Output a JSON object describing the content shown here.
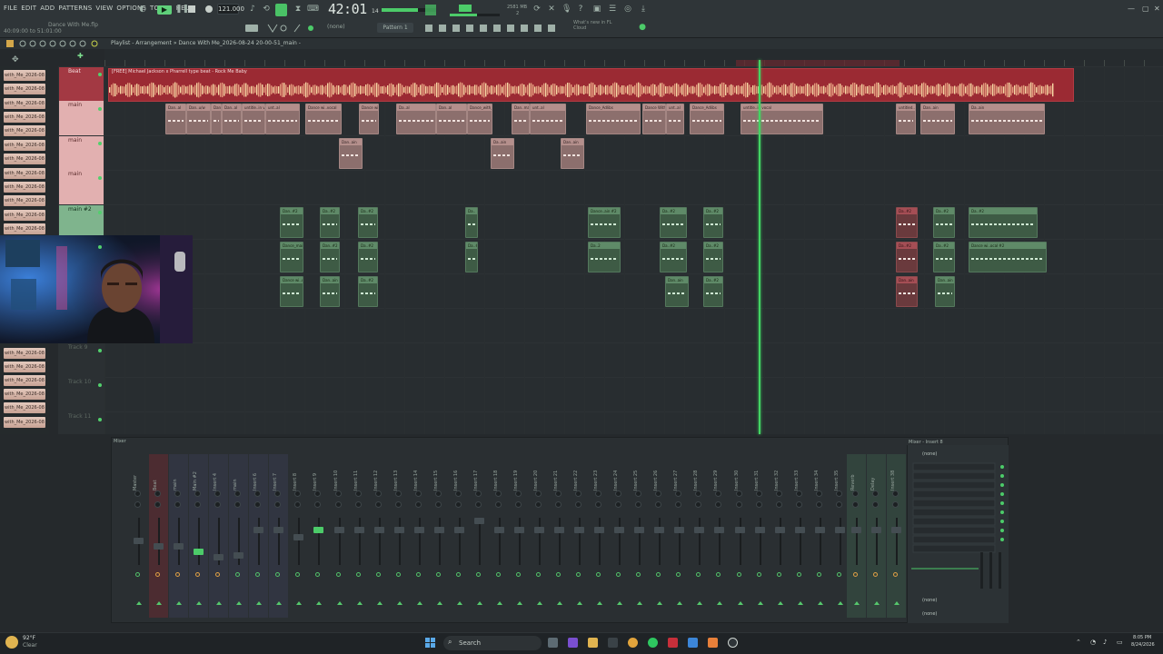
{
  "menu": [
    "FILE",
    "EDIT",
    "ADD",
    "PATTERNS",
    "VIEW",
    "OPTIONS",
    "TOOLS",
    "HELP"
  ],
  "project": {
    "name": "Dance With Me.flp",
    "time": "40:09:00 to 51:01:00"
  },
  "transport": {
    "tempo": "121.000",
    "time": "42:01",
    "time_small": "14",
    "cpu": "2581 MB",
    "cpu2": "2"
  },
  "toolbar": {
    "pattern": "Pattern 1",
    "none": "(none)",
    "news": "What's new in FL",
    "news_sub": "Cloud"
  },
  "playlist": {
    "title": "Playlist - Arrangement » Dance With Me_2026-08-24 20-00-51_main -"
  },
  "picker": [
    "with_Me_2026-08",
    "with_Me_2026-08",
    "with_Me_2026-08",
    "with_Me_2026-08",
    "with_Me_2026-08",
    "with_Me_2026-08",
    "with_Me_2026-08",
    "with_Me_2026-08",
    "with_Me_2026-08",
    "with_Me_2026-08",
    "with_Me_2026-08",
    "with_Me_2026-08",
    "with_Me_2026-08",
    "with_Me_2026-08",
    "with_Me_2026-08",
    "with_Me_2026-08",
    "with_Me_2026-08",
    "with_Me_2026-08",
    "with_Me_2026-08"
  ],
  "tracks": [
    "Beat",
    "main",
    "main",
    "main",
    "main #2",
    "Track 9",
    "Track 10",
    "Track 11"
  ],
  "beat_clip": {
    "label": "[FREE] Michael Jackson x Pharrell type beat - Rock Me Baby"
  },
  "clips_pink": [
    "Dan..al",
    "Dan..u/w",
    "Dan..al",
    "Dan..al",
    "untitle..in vocal",
    "unt..al",
    "Dance wi..vocal",
    "Dance wi..vocal",
    "Da..al",
    "Dan..al",
    "Dance_with_16-15_main",
    "Dan..mai",
    "unt..al",
    "Dance_Adlibs",
    "Dance With Me_202...23 23-15-21_main",
    "unt..al",
    "Dance_Adlibs",
    "untitle..in vocal",
    "untitled..in vocal",
    "Dan..ain",
    "Da..ain",
    "Dan..ain"
  ],
  "clips_green": [
    "Dan..#2",
    "Da..#2",
    "Da..#2",
    "Da..",
    "Dance..ain #2",
    "Da..#2",
    "Da..#2",
    "Da..#2",
    "Da..#2",
    "Dance_main #2",
    "Dan..#2",
    "Da..#2",
    "Da..#2",
    "Da..2",
    "Da..#2",
    "Da..#2",
    "Da..#2",
    "Dance wi..ocal #2",
    "Dance wi..ocal #2",
    "Dan..ain",
    "Da..#2",
    "Dan..ain",
    "Da..#2",
    "Dan..ain"
  ],
  "mixer": {
    "title": "Mixer",
    "insert_title": "Mixer - Insert 8",
    "none1": "(none)",
    "none2": "(none)",
    "none3": "(none)",
    "channels": [
      "Master",
      "Beat",
      "main",
      "Main #2",
      "Insert 4",
      "main",
      "Insert 6",
      "Insert 7",
      "Insert 8",
      "Insert 9",
      "Insert 10",
      "Insert 11",
      "Insert 12",
      "Insert 13",
      "Insert 14",
      "Insert 15",
      "Insert 16",
      "Insert 17",
      "Insert 18",
      "Insert 19",
      "Insert 20",
      "Insert 21",
      "Insert 22",
      "Insert 23",
      "Insert 24",
      "Insert 25",
      "Insert 26",
      "Insert 27",
      "Insert 28",
      "Insert 29",
      "Insert 30",
      "Insert 31",
      "Insert 32",
      "Insert 33",
      "Insert 34",
      "Insert 35",
      "Reverb",
      "Delay",
      "Insert 38"
    ]
  },
  "taskbar": {
    "weather_temp": "92°F",
    "weather_cond": "Clear",
    "search": "Search",
    "clock": "8:05 PM",
    "date": "8/24/2026"
  },
  "colors": {
    "accent": "#43d463",
    "beat": "#9b2a33",
    "clip": "#8c6f6d",
    "clip_green": "#3e5b45"
  }
}
